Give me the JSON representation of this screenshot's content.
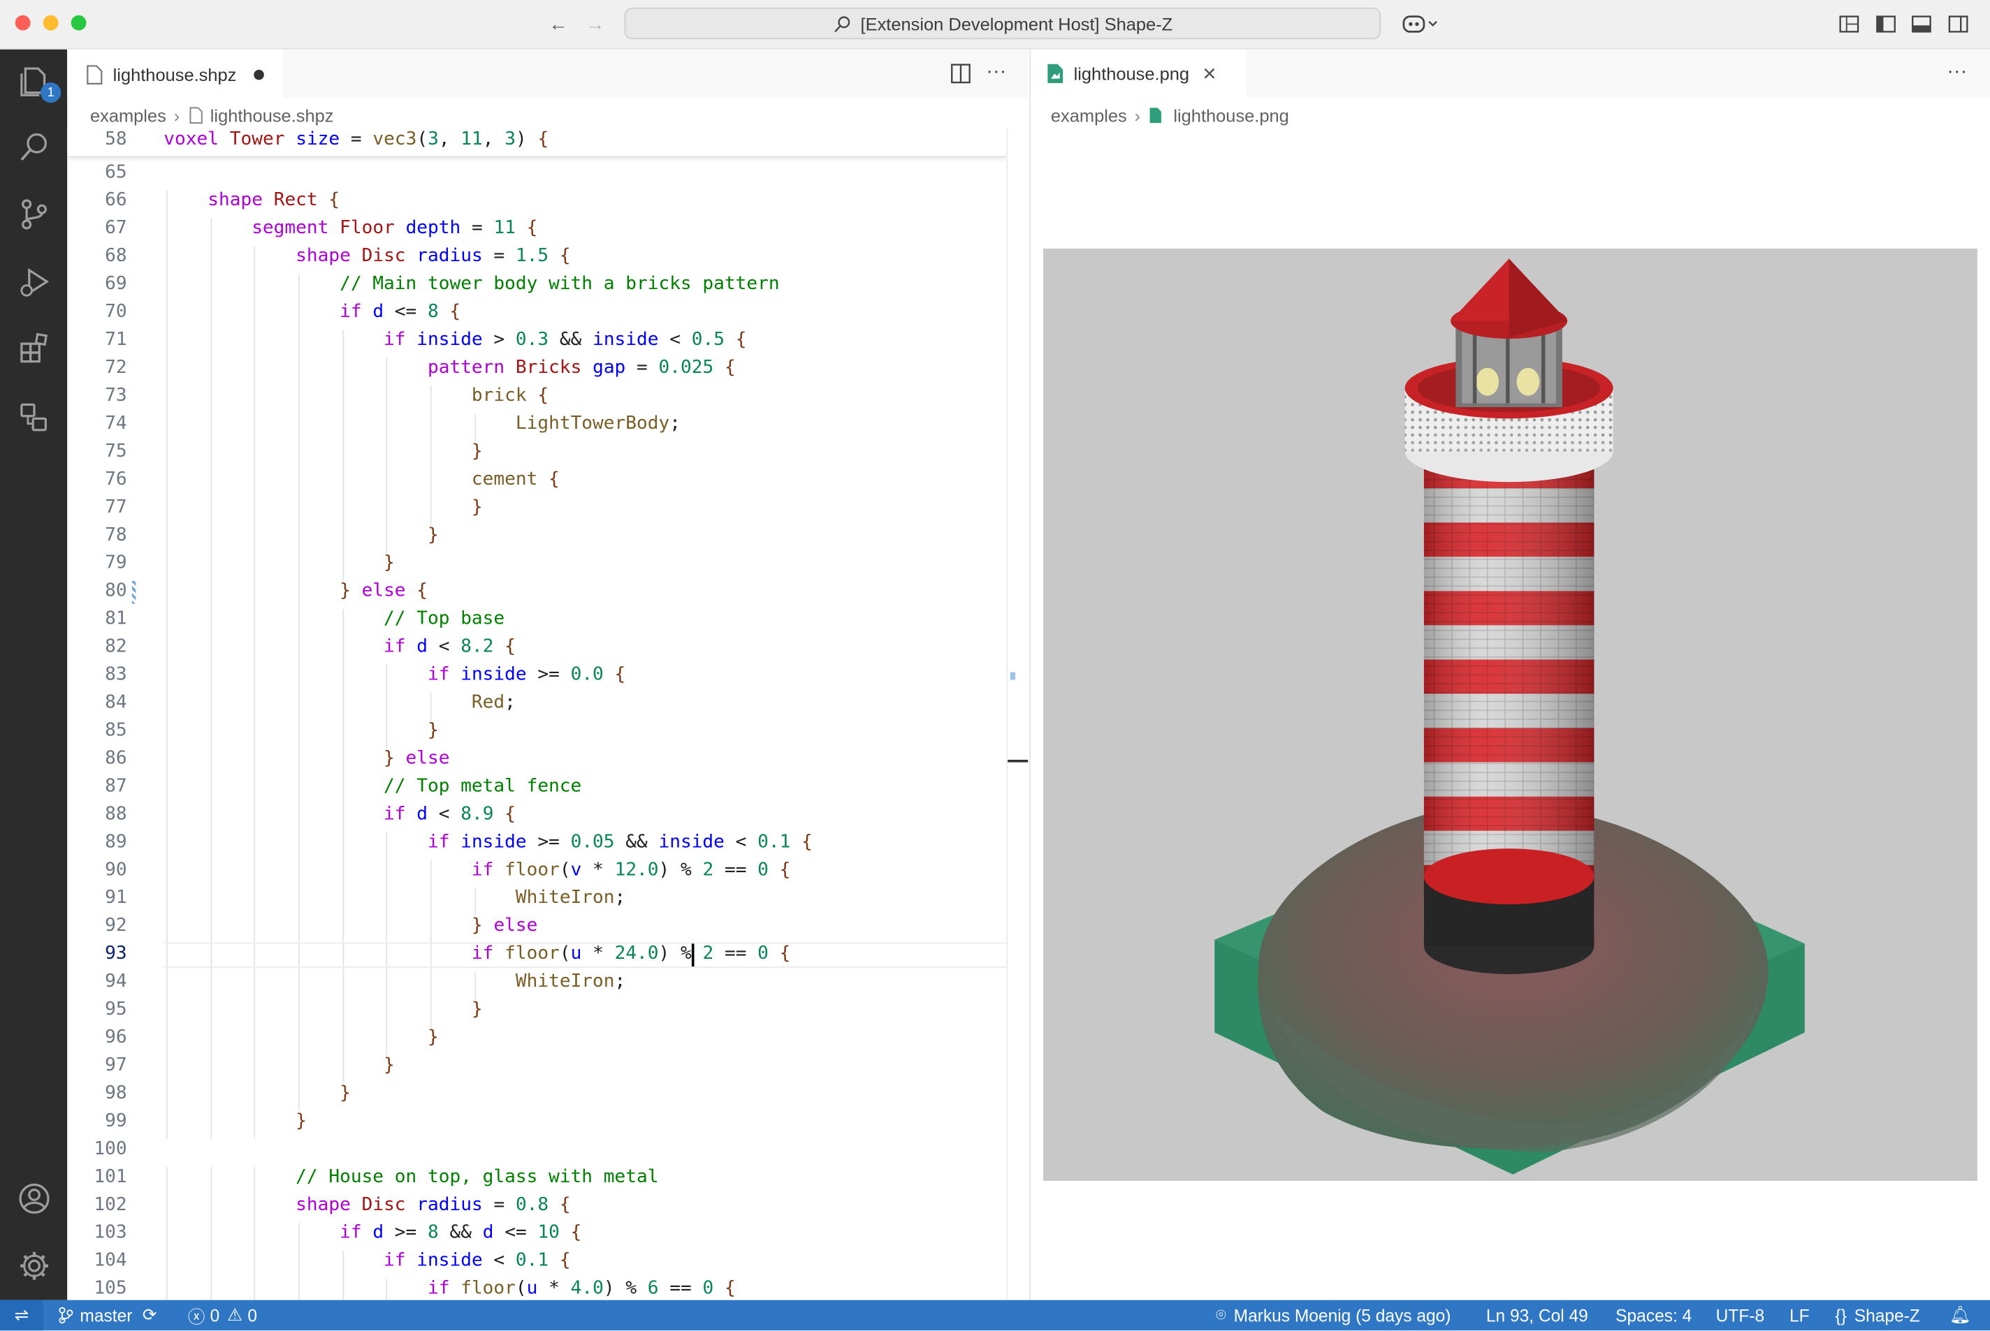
{
  "window": {
    "title": "[Extension Development Host] Shape-Z"
  },
  "colors": {
    "accent": "#2f77c4",
    "activity_bg": "#2c2c2c",
    "badge": "#2f77c4"
  },
  "activity": {
    "explorer_badge": "1"
  },
  "left_editor": {
    "tab_label": "lighthouse.shpz",
    "breadcrumb": [
      "examples",
      "lighthouse.shpz"
    ],
    "sticky": {
      "line": "58",
      "text": "voxel Tower size = vec3(3, 11, 3) {"
    },
    "lines": [
      {
        "n": "65",
        "t": ""
      },
      {
        "n": "66",
        "t": "    shape Rect {"
      },
      {
        "n": "67",
        "t": "        segment Floor depth = 11 {"
      },
      {
        "n": "68",
        "t": "            shape Disc radius = 1.5 {"
      },
      {
        "n": "69",
        "t": "                // Main tower body with a bricks pattern"
      },
      {
        "n": "70",
        "t": "                if d <= 8 {"
      },
      {
        "n": "71",
        "t": "                    if inside > 0.3 && inside < 0.5 {"
      },
      {
        "n": "72",
        "t": "                        pattern Bricks gap = 0.025 {"
      },
      {
        "n": "73",
        "t": "                            brick {"
      },
      {
        "n": "74",
        "t": "                                LightTowerBody;"
      },
      {
        "n": "75",
        "t": "                            }"
      },
      {
        "n": "76",
        "t": "                            cement {"
      },
      {
        "n": "77",
        "t": "                            }"
      },
      {
        "n": "78",
        "t": "                        }"
      },
      {
        "n": "79",
        "t": "                    }"
      },
      {
        "n": "80",
        "t": "                } else {"
      },
      {
        "n": "81",
        "t": "                    // Top base"
      },
      {
        "n": "82",
        "t": "                    if d < 8.2 {"
      },
      {
        "n": "83",
        "t": "                        if inside >= 0.0 {"
      },
      {
        "n": "84",
        "t": "                            Red;"
      },
      {
        "n": "85",
        "t": "                        }"
      },
      {
        "n": "86",
        "t": "                    } else"
      },
      {
        "n": "87",
        "t": "                    // Top metal fence"
      },
      {
        "n": "88",
        "t": "                    if d < 8.9 {"
      },
      {
        "n": "89",
        "t": "                        if inside >= 0.05 && inside < 0.1 {"
      },
      {
        "n": "90",
        "t": "                            if floor(v * 12.0) % 2 == 0 {"
      },
      {
        "n": "91",
        "t": "                                WhiteIron;"
      },
      {
        "n": "92",
        "t": "                            } else"
      },
      {
        "n": "93",
        "t": "                            if floor(u * 24.0) % 2 == 0 {"
      },
      {
        "n": "94",
        "t": "                                WhiteIron;"
      },
      {
        "n": "95",
        "t": "                            }"
      },
      {
        "n": "96",
        "t": "                        }"
      },
      {
        "n": "97",
        "t": "                    }"
      },
      {
        "n": "98",
        "t": "                }"
      },
      {
        "n": "99",
        "t": "            }"
      },
      {
        "n": "100",
        "t": ""
      },
      {
        "n": "101",
        "t": "            // House on top, glass with metal"
      },
      {
        "n": "102",
        "t": "            shape Disc radius = 0.8 {"
      },
      {
        "n": "103",
        "t": "                if d >= 8 && d <= 10 {"
      },
      {
        "n": "104",
        "t": "                    if inside < 0.1 {"
      },
      {
        "n": "105",
        "t": "                        if floor(u * 4.0) % 6 == 0 {"
      }
    ]
  },
  "right_editor": {
    "tab_label": "lighthouse.png",
    "breadcrumb": [
      "examples",
      "lighthouse.png"
    ]
  },
  "status": {
    "branch": "master",
    "errors": "0",
    "warnings": "0",
    "blame": "Markus Moenig (5 days ago)",
    "position": "Ln 93, Col 49",
    "spaces": "Spaces: 4",
    "encoding": "UTF-8",
    "eol": "LF",
    "language": "Shape-Z"
  }
}
